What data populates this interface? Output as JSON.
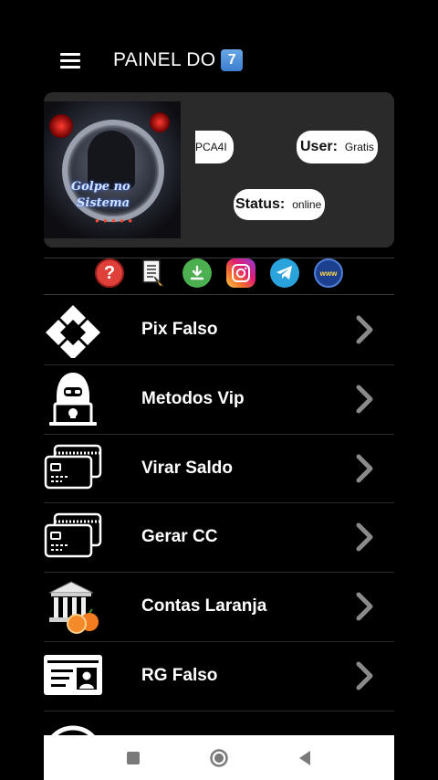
{
  "header": {
    "title": "PAINEL DO",
    "title_badge": "7"
  },
  "profile": {
    "banner_text_line1": "Golpe no",
    "banner_text_line2": "Sistema",
    "key_value": "PCA4I",
    "user_label": "User:",
    "user_value": "Gratis",
    "status_label": "Status:",
    "status_value": "online"
  },
  "quick_icons": [
    "help-icon",
    "document-icon",
    "download-icon",
    "instagram-icon",
    "telegram-icon",
    "www-icon"
  ],
  "menu": {
    "items": [
      {
        "label": "Pix Falso",
        "icon": "pix-icon"
      },
      {
        "label": "Metodos Vip",
        "icon": "hacker-icon"
      },
      {
        "label": "Virar Saldo",
        "icon": "cards-icon"
      },
      {
        "label": "Gerar CC",
        "icon": "cards-icon"
      },
      {
        "label": "Contas Laranja",
        "icon": "bank-orange-icon"
      },
      {
        "label": "RG Falso",
        "icon": "id-card-icon"
      }
    ]
  },
  "navbar": {
    "buttons": [
      "recents-square-icon",
      "home-circle-icon",
      "back-triangle-icon"
    ]
  }
}
